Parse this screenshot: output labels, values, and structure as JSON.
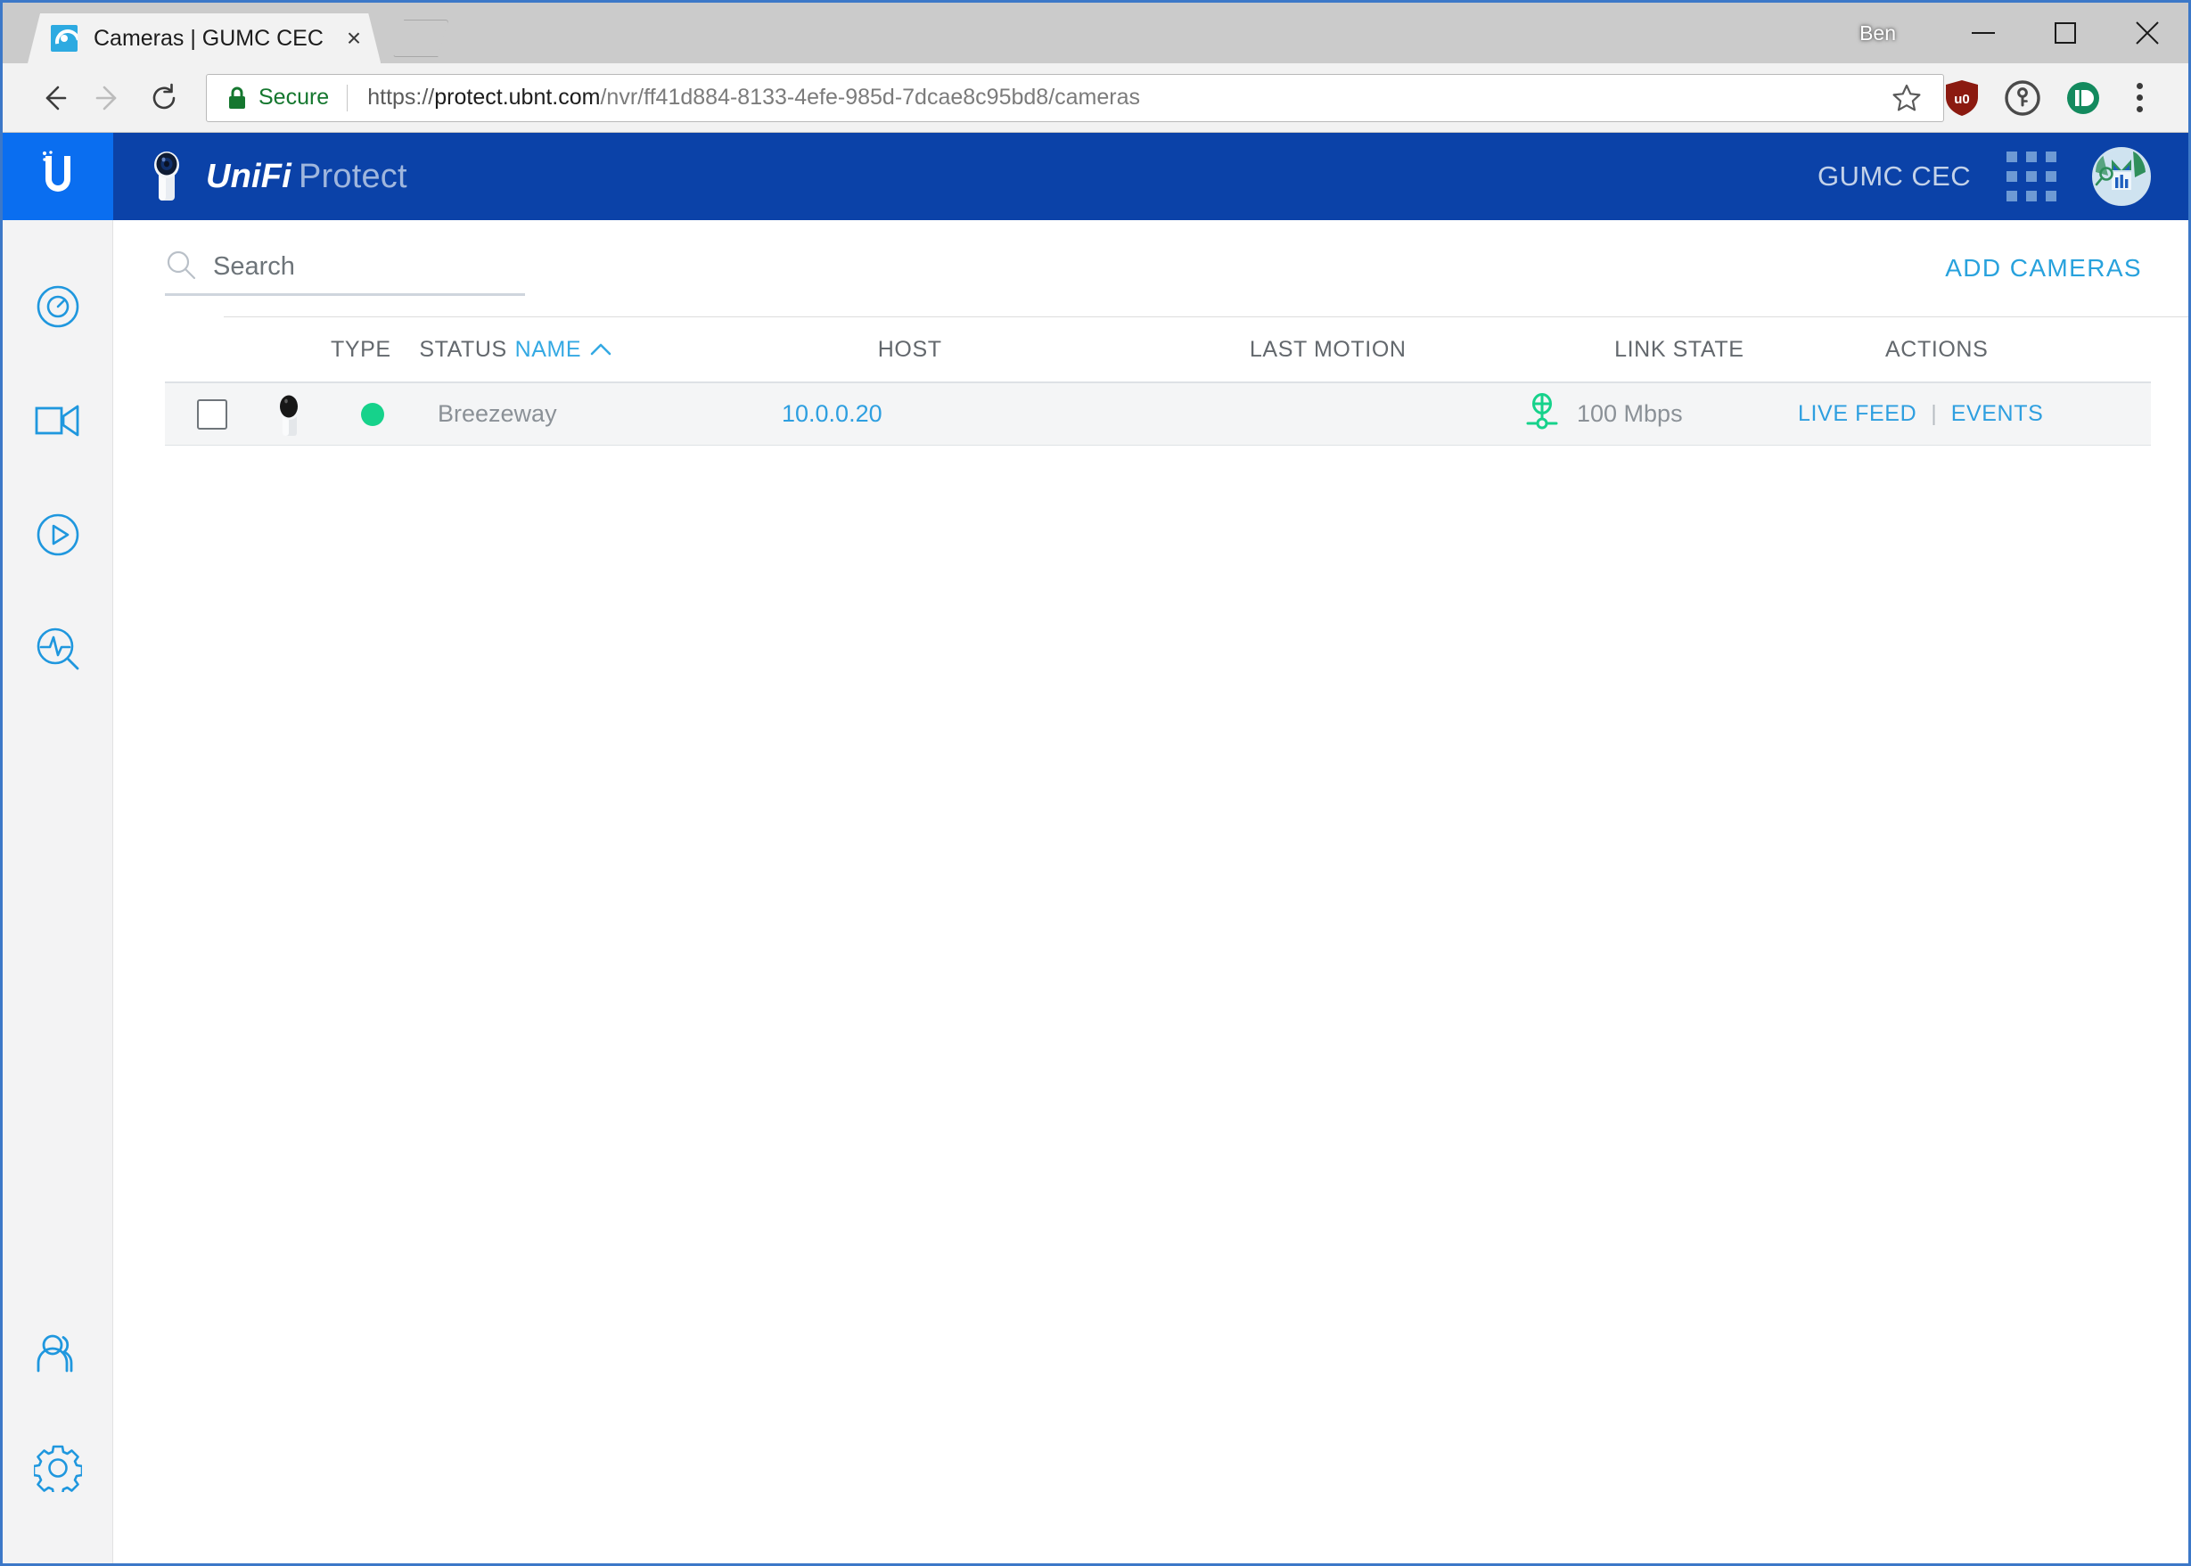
{
  "browser": {
    "profile_name": "Ben",
    "window_controls": [
      "minimize",
      "maximize",
      "close"
    ],
    "tab": {
      "title": "Cameras | GUMC CEC",
      "favicon": "unifi-protect-swirl-icon",
      "close_label": "×"
    },
    "new_tab_label": "+",
    "nav": {
      "back": "back-arrow-icon",
      "forward": "forward-arrow-icon",
      "reload": "reload-icon"
    },
    "omnibox": {
      "security_label": "Secure",
      "lock_icon": "padlock-icon",
      "url_scheme": "https://",
      "url_host": "protect.ubnt.com",
      "url_path": "/nvr/ff41d884-8133-4efe-985d-7dcae8c95bd8/cameras",
      "url_full": "https://protect.ubnt.com/nvr/ff41d884-8133-4efe-985d-7dcae8c95bd8/cameras"
    },
    "extensions": [
      {
        "name": "bookmark-star-icon",
        "color": "#5a5a5a"
      },
      {
        "name": "ublock-origin-icon",
        "color": "#8b1a10"
      },
      {
        "name": "1password-icon",
        "color": "#4a4a4a"
      },
      {
        "name": "pushbullet-icon",
        "color": "#138a5e"
      }
    ],
    "menu_icon": "three-dot-menu-icon"
  },
  "sidebar": {
    "logo": "ubiquiti-u-logo",
    "logo_bg": "#0a6ef0",
    "items": [
      {
        "icon": "dashboard-radar-icon",
        "active": true
      },
      {
        "icon": "video-camera-icon",
        "active": false
      },
      {
        "icon": "play-circle-icon",
        "active": false
      },
      {
        "icon": "activity-search-icon",
        "active": false
      }
    ],
    "bottom_items": [
      {
        "icon": "users-icon"
      },
      {
        "icon": "gear-icon"
      }
    ]
  },
  "appbar": {
    "brand_primary": "UniFi",
    "brand_secondary": "Protect",
    "brand_icon": "camera-product-icon",
    "site_name": "GUMC CEC",
    "apps_grid_icon": "apps-grid-icon",
    "avatar_icon": "user-avatar-owl-image",
    "bg_color": "#0b42a8"
  },
  "search": {
    "icon": "search-icon",
    "placeholder": "Search",
    "value": ""
  },
  "actions_bar": {
    "add_cameras_label": "ADD CAMERAS",
    "accent_color": "#28a2dd"
  },
  "table": {
    "columns": [
      {
        "key": "type",
        "label": "TYPE",
        "sorted": false
      },
      {
        "key": "status",
        "label": "STATUS",
        "sorted": false
      },
      {
        "key": "name",
        "label": "NAME",
        "sorted": true,
        "sort_dir": "asc",
        "sort_icon": "chevron-up-icon"
      },
      {
        "key": "host",
        "label": "HOST",
        "sorted": false
      },
      {
        "key": "last_motion",
        "label": "LAST MOTION",
        "sorted": false
      },
      {
        "key": "link_state",
        "label": "LINK STATE",
        "sorted": false
      },
      {
        "key": "actions",
        "label": "ACTIONS",
        "sorted": false
      }
    ],
    "rows": [
      {
        "selected": false,
        "type_icon": "unifi-camera-thumbnail",
        "status": "online",
        "status_color": "#16d28b",
        "name": "Breezeway",
        "host": "10.0.0.20",
        "last_motion": "",
        "link_icon": "ethernet-link-icon",
        "link_speed": "100 Mbps",
        "action_live_feed": "LIVE FEED",
        "action_separator": "|",
        "action_events": "EVENTS"
      }
    ]
  }
}
